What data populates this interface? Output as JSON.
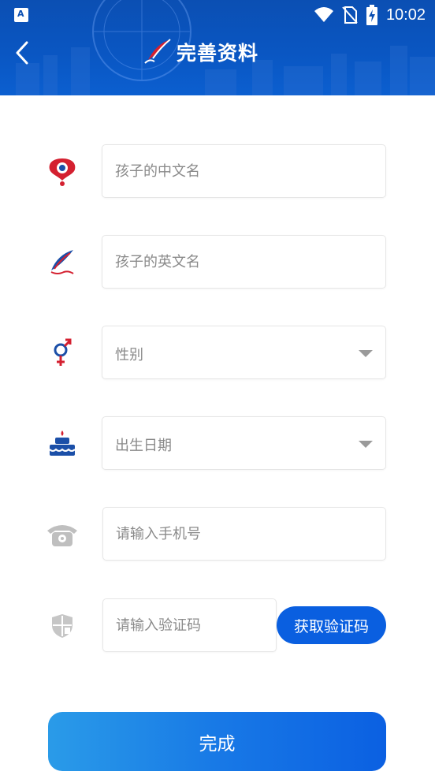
{
  "statusbar": {
    "time": "10:02"
  },
  "header": {
    "title": "完善资料"
  },
  "form": {
    "chinese_name": {
      "placeholder": "孩子的中文名",
      "value": ""
    },
    "english_name": {
      "placeholder": "孩子的英文名",
      "value": ""
    },
    "gender": {
      "label": "性别"
    },
    "birthday": {
      "label": "出生日期"
    },
    "phone": {
      "placeholder": "请输入手机号",
      "value": ""
    },
    "code": {
      "placeholder": "请输入验证码",
      "value": ""
    },
    "get_code_label": "获取验证码"
  },
  "submit_label": "完成",
  "colors": {
    "brand_blue": "#0a5fe0",
    "header_blue": "#0b4fb3",
    "accent_red": "#d42030"
  }
}
